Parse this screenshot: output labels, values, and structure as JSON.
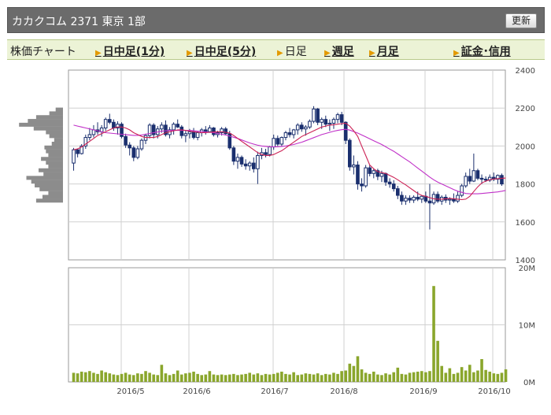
{
  "header": {
    "title": "カカクコム  2371  東京 1部",
    "refresh_label": "更新"
  },
  "nav": {
    "label": "株価チャート",
    "items": [
      {
        "label": "日中足(1分)",
        "link": true
      },
      {
        "label": "日中足(5分)",
        "link": true
      },
      {
        "label": "日足",
        "link": false
      },
      {
        "label": "週足",
        "link": true
      },
      {
        "label": "月足",
        "link": true
      },
      {
        "label": "証金･信用",
        "link": true
      }
    ]
  },
  "colors": {
    "candle": "#1a2f6e",
    "ma_short": "#cc2255",
    "ma_long": "#c030c8",
    "volume": "#8aa62c",
    "profile": "#8c8c8c",
    "grid": "#d0d0d0"
  },
  "chart_data": {
    "type": "candlestick",
    "price_axis": {
      "min": 1400,
      "max": 2400,
      "ticks": [
        1400,
        1600,
        1800,
        2000,
        2200,
        2400
      ]
    },
    "volume_axis": {
      "min": 0,
      "max": 20000000,
      "ticks": [
        {
          "value": 0,
          "label": "0M"
        },
        {
          "value": 10000000,
          "label": "10M"
        },
        {
          "value": 20000000,
          "label": "20M"
        }
      ]
    },
    "x_labels": [
      "2016/5",
      "2016/6",
      "2016/7",
      "2016/8",
      "2016/9",
      "2016/10"
    ],
    "candles": [
      [
        1910,
        1990,
        1870,
        1980
      ],
      [
        1980,
        1985,
        1940,
        1960
      ],
      [
        1960,
        2010,
        1955,
        2000
      ],
      [
        2000,
        2060,
        1985,
        2045
      ],
      [
        2045,
        2095,
        2030,
        2060
      ],
      [
        2060,
        2110,
        2045,
        2085
      ],
      [
        2085,
        2125,
        2060,
        2075
      ],
      [
        2075,
        2110,
        2050,
        2095
      ],
      [
        2095,
        2150,
        2080,
        2140
      ],
      [
        2140,
        2170,
        2115,
        2125
      ],
      [
        2125,
        2140,
        2080,
        2095
      ],
      [
        2095,
        2130,
        2060,
        2115
      ],
      [
        2115,
        2125,
        2040,
        2050
      ],
      [
        2050,
        2065,
        1990,
        2005
      ],
      [
        2005,
        2020,
        1950,
        1990
      ],
      [
        1990,
        2000,
        1920,
        1940
      ],
      [
        1940,
        2000,
        1930,
        1985
      ],
      [
        1985,
        2040,
        1975,
        2030
      ],
      [
        2030,
        2065,
        2010,
        2055
      ],
      [
        2055,
        2120,
        2040,
        2110
      ],
      [
        2110,
        2120,
        2040,
        2060
      ],
      [
        2060,
        2105,
        2040,
        2090
      ],
      [
        2090,
        2125,
        2070,
        2110
      ],
      [
        2110,
        2135,
        2050,
        2060
      ],
      [
        2060,
        2100,
        2040,
        2085
      ],
      [
        2085,
        2125,
        2060,
        2115
      ],
      [
        2115,
        2140,
        2095,
        2100
      ],
      [
        2100,
        2110,
        2040,
        2055
      ],
      [
        2055,
        2080,
        2020,
        2065
      ],
      [
        2065,
        2090,
        2040,
        2075
      ],
      [
        2075,
        2095,
        2035,
        2045
      ],
      [
        2045,
        2080,
        2030,
        2070
      ],
      [
        2070,
        2095,
        2050,
        2085
      ],
      [
        2085,
        2105,
        2060,
        2075
      ],
      [
        2075,
        2110,
        2070,
        2095
      ],
      [
        2095,
        2100,
        2050,
        2060
      ],
      [
        2060,
        2080,
        2045,
        2070
      ],
      [
        2070,
        2100,
        2055,
        2090
      ],
      [
        2090,
        2100,
        2060,
        2065
      ],
      [
        2065,
        2080,
        1980,
        1990
      ],
      [
        1990,
        2000,
        1900,
        1920
      ],
      [
        1920,
        1960,
        1880,
        1940
      ],
      [
        1940,
        1950,
        1890,
        1905
      ],
      [
        1905,
        1930,
        1875,
        1895
      ],
      [
        1895,
        1920,
        1870,
        1910
      ],
      [
        1910,
        1940,
        1860,
        1880
      ],
      [
        1880,
        1970,
        1800,
        1950
      ],
      [
        1950,
        1990,
        1930,
        1965
      ],
      [
        1965,
        1985,
        1940,
        1955
      ],
      [
        1955,
        2000,
        1945,
        1995
      ],
      [
        1995,
        2060,
        1980,
        2040
      ],
      [
        2040,
        2055,
        2000,
        2010
      ],
      [
        2010,
        2050,
        2000,
        2045
      ],
      [
        2045,
        2080,
        2030,
        2070
      ],
      [
        2070,
        2095,
        2045,
        2060
      ],
      [
        2060,
        2090,
        2040,
        2085
      ],
      [
        2085,
        2120,
        2060,
        2110
      ],
      [
        2110,
        2125,
        2075,
        2090
      ],
      [
        2090,
        2110,
        2055,
        2100
      ],
      [
        2100,
        2140,
        2090,
        2130
      ],
      [
        2130,
        2210,
        2120,
        2195
      ],
      [
        2195,
        2200,
        2110,
        2125
      ],
      [
        2125,
        2150,
        2090,
        2140
      ],
      [
        2140,
        2160,
        2100,
        2115
      ],
      [
        2115,
        2140,
        2080,
        2120
      ],
      [
        2120,
        2150,
        2090,
        2140
      ],
      [
        2140,
        2175,
        2120,
        2165
      ],
      [
        2165,
        2180,
        2110,
        2125
      ],
      [
        2125,
        2130,
        2010,
        2030
      ],
      [
        2030,
        2040,
        1870,
        1890
      ],
      [
        1890,
        1950,
        1850,
        1900
      ],
      [
        1900,
        1920,
        1770,
        1800
      ],
      [
        1800,
        1830,
        1760,
        1790
      ],
      [
        1790,
        1900,
        1780,
        1885
      ],
      [
        1885,
        1900,
        1840,
        1855
      ],
      [
        1855,
        1880,
        1830,
        1870
      ],
      [
        1870,
        1880,
        1820,
        1840
      ],
      [
        1840,
        1870,
        1810,
        1855
      ],
      [
        1855,
        1860,
        1790,
        1810
      ],
      [
        1810,
        1830,
        1780,
        1800
      ],
      [
        1800,
        1820,
        1760,
        1775
      ],
      [
        1775,
        1790,
        1720,
        1740
      ],
      [
        1740,
        1760,
        1690,
        1710
      ],
      [
        1710,
        1740,
        1690,
        1725
      ],
      [
        1725,
        1740,
        1700,
        1715
      ],
      [
        1715,
        1740,
        1700,
        1730
      ],
      [
        1730,
        1760,
        1710,
        1720
      ],
      [
        1720,
        1740,
        1700,
        1735
      ],
      [
        1735,
        1760,
        1700,
        1710
      ],
      [
        1710,
        1800,
        1560,
        1700
      ],
      [
        1700,
        1760,
        1690,
        1745
      ],
      [
        1745,
        1760,
        1700,
        1710
      ],
      [
        1710,
        1740,
        1690,
        1730
      ],
      [
        1730,
        1745,
        1700,
        1715
      ],
      [
        1715,
        1730,
        1690,
        1720
      ],
      [
        1720,
        1750,
        1700,
        1710
      ],
      [
        1710,
        1760,
        1700,
        1740
      ],
      [
        1740,
        1800,
        1730,
        1790
      ],
      [
        1790,
        1860,
        1780,
        1840
      ],
      [
        1840,
        1880,
        1800,
        1815
      ],
      [
        1815,
        1960,
        1810,
        1870
      ],
      [
        1870,
        1880,
        1820,
        1830
      ],
      [
        1830,
        1850,
        1800,
        1825
      ],
      [
        1825,
        1840,
        1810,
        1820
      ],
      [
        1820,
        1850,
        1810,
        1835
      ],
      [
        1835,
        1860,
        1815,
        1825
      ],
      [
        1825,
        1850,
        1800,
        1845
      ],
      [
        1845,
        1855,
        1790,
        1800
      ]
    ],
    "ma_short": [
      1980,
      1985,
      1995,
      2010,
      2025,
      2040,
      2055,
      2065,
      2075,
      2085,
      2095,
      2100,
      2100,
      2095,
      2085,
      2070,
      2060,
      2050,
      2045,
      2045,
      2045,
      2050,
      2060,
      2070,
      2075,
      2080,
      2085,
      2085,
      2082,
      2078,
      2075,
      2072,
      2070,
      2070,
      2072,
      2074,
      2075,
      2075,
      2072,
      2068,
      2055,
      2040,
      2025,
      2010,
      1995,
      1980,
      1965,
      1955,
      1950,
      1950,
      1955,
      1965,
      1975,
      1990,
      2005,
      2020,
      2035,
      2050,
      2060,
      2070,
      2080,
      2090,
      2100,
      2105,
      2110,
      2112,
      2115,
      2118,
      2120,
      2105,
      2080,
      2050,
      2000,
      1950,
      1900,
      1880,
      1865,
      1860,
      1855,
      1845,
      1835,
      1822,
      1808,
      1795,
      1780,
      1765,
      1750,
      1740,
      1735,
      1728,
      1722,
      1720,
      1720,
      1722,
      1724,
      1722,
      1720,
      1718,
      1720,
      1735,
      1760,
      1785,
      1805,
      1815,
      1822,
      1826,
      1828,
      1830,
      1831
    ],
    "ma_long": [
      2110,
      2105,
      2100,
      2095,
      2090,
      2085,
      2080,
      2075,
      2070,
      2068,
      2066,
      2064,
      2062,
      2060,
      2058,
      2056,
      2056,
      2058,
      2062,
      2066,
      2070,
      2074,
      2078,
      2080,
      2082,
      2082,
      2082,
      2082,
      2082,
      2082,
      2080,
      2078,
      2076,
      2074,
      2072,
      2070,
      2066,
      2062,
      2058,
      2052,
      2046,
      2040,
      2032,
      2024,
      2016,
      2010,
      2004,
      2000,
      1998,
      1996,
      1996,
      1996,
      1998,
      2000,
      2004,
      2008,
      2014,
      2020,
      2028,
      2036,
      2044,
      2052,
      2060,
      2066,
      2072,
      2078,
      2082,
      2086,
      2088,
      2084,
      2076,
      2068,
      2058,
      2048,
      2038,
      2028,
      2018,
      2008,
      1996,
      1984,
      1972,
      1958,
      1944,
      1930,
      1916,
      1900,
      1884,
      1868,
      1852,
      1836,
      1822,
      1810,
      1800,
      1790,
      1780,
      1770,
      1762,
      1756,
      1750,
      1748,
      1748,
      1748,
      1750,
      1752,
      1754,
      1756,
      1758,
      1762,
      1766
    ],
    "volumes": [
      1.6,
      1.5,
      1.8,
      1.7,
      1.9,
      1.6,
      1.4,
      2.0,
      1.7,
      1.5,
      1.3,
      1.2,
      1.4,
      1.6,
      1.3,
      1.2,
      1.5,
      1.4,
      1.9,
      1.6,
      1.3,
      1.2,
      3.0,
      1.5,
      1.2,
      1.4,
      2.0,
      1.3,
      1.5,
      1.6,
      1.8,
      1.4,
      1.2,
      1.3,
      1.9,
      1.3,
      1.2,
      1.3,
      1.2,
      1.3,
      1.4,
      1.2,
      1.3,
      1.4,
      1.6,
      1.3,
      1.5,
      1.2,
      1.4,
      1.3,
      1.4,
      1.6,
      1.8,
      1.4,
      1.3,
      1.7,
      1.2,
      1.3,
      1.5,
      1.4,
      1.3,
      1.5,
      1.2,
      1.4,
      1.3,
      1.6,
      1.4,
      1.9,
      2.0,
      3.2,
      2.8,
      4.5,
      2.2,
      1.6,
      1.4,
      1.8,
      1.3,
      1.2,
      1.5,
      1.3,
      1.7,
      2.5,
      1.4,
      1.3,
      1.6,
      1.7,
      1.8,
      1.9,
      1.7,
      1.9,
      16.8,
      7.2,
      2.8,
      1.6,
      2.4,
      1.4,
      1.6,
      2.6,
      2.0,
      3.0,
      1.7,
      2.0,
      4.0,
      2.1,
      1.8,
      1.5,
      1.4,
      1.6,
      2.2
    ],
    "volume_unit_millions": true,
    "price_profile": [
      {
        "price": 2190,
        "weight": 0.15
      },
      {
        "price": 2170,
        "weight": 0.28
      },
      {
        "price": 2150,
        "weight": 0.55
      },
      {
        "price": 2130,
        "weight": 0.72
      },
      {
        "price": 2110,
        "weight": 0.9
      },
      {
        "price": 2090,
        "weight": 0.6
      },
      {
        "price": 2070,
        "weight": 0.35
      },
      {
        "price": 2050,
        "weight": 0.28
      },
      {
        "price": 2030,
        "weight": 0.18
      },
      {
        "price": 2010,
        "weight": 0.23
      },
      {
        "price": 1990,
        "weight": 0.38
      },
      {
        "price": 1970,
        "weight": 0.35
      },
      {
        "price": 1950,
        "weight": 0.3
      },
      {
        "price": 1930,
        "weight": 0.45
      },
      {
        "price": 1910,
        "weight": 0.35
      },
      {
        "price": 1890,
        "weight": 0.3
      },
      {
        "price": 1870,
        "weight": 0.5
      },
      {
        "price": 1850,
        "weight": 0.4
      },
      {
        "price": 1830,
        "weight": 0.75
      },
      {
        "price": 1810,
        "weight": 0.65
      },
      {
        "price": 1790,
        "weight": 0.58
      },
      {
        "price": 1770,
        "weight": 0.48
      },
      {
        "price": 1750,
        "weight": 0.3
      },
      {
        "price": 1730,
        "weight": 0.42
      },
      {
        "price": 1710,
        "weight": 0.55
      }
    ]
  }
}
